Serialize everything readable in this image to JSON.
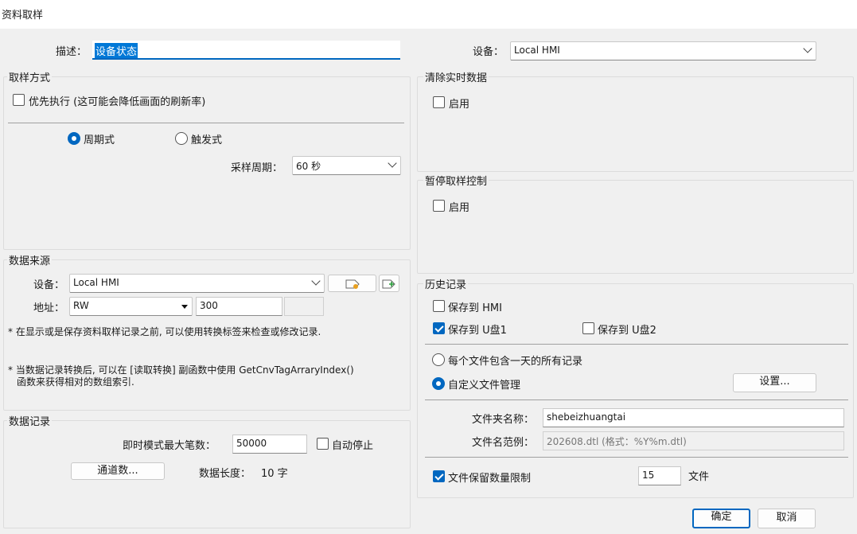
{
  "window": {
    "title": "资料取样"
  },
  "top": {
    "desc_label": "描述：",
    "desc_value": "设备状态",
    "device_label": "设备：",
    "device_value": "Local HMI"
  },
  "sampling": {
    "title": "取样方式",
    "priority_label": "优先执行 (这可能会降低画面的刷新率)",
    "priority_checked": false,
    "periodic_label": "周期式",
    "trigger_label": "触发式",
    "selected_mode": "periodic",
    "period_label": "采样周期：",
    "period_value": "60 秒"
  },
  "clear_realtime": {
    "title": "清除实时数据",
    "enable_label": "启用",
    "checked": false
  },
  "pause": {
    "title": "暂停取样控制",
    "enable_label": "启用",
    "checked": false
  },
  "source": {
    "title": "数据来源",
    "device_label": "设备：",
    "device_value": "Local HMI",
    "address_label": "地址：",
    "address_type": "RW",
    "address_value": "300",
    "note1": "* 在显示或是保存资料取样记录之前, 可以使用转换标签来检查或修改记录.",
    "note2_line1": "* 当数据记录转换后, 可以在 [读取转换] 副函数中使用 GetCnvTagArraryIndex()",
    "note2_line2": "函数来获得相对的数组索引."
  },
  "record": {
    "title": "数据记录",
    "max_label": "即时模式最大笔数：",
    "max_value": "50000",
    "auto_stop_label": "自动停止",
    "auto_stop_checked": false,
    "channel_button": "通道数...",
    "length_label": "数据长度：",
    "length_value": "10 字"
  },
  "history": {
    "title": "历史记录",
    "save_hmi_label": "保存到 HMI",
    "save_hmi_checked": false,
    "save_u1_label": "保存到 U盘1",
    "save_u1_checked": true,
    "save_u2_label": "保存到 U盘2",
    "save_u2_checked": false,
    "per_day_label": "每个文件包含一天的所有记录",
    "custom_label": "自定义文件管理",
    "selected_file_mode": "custom",
    "settings_button": "设置...",
    "folder_label": "文件夹名称：",
    "folder_value": "shebeizhuangtai",
    "example_label": "文件名范例：",
    "example_value": "202608.dtl (格式：%Y%m.dtl)",
    "limit_label": "文件保留数量限制",
    "limit_checked": true,
    "limit_value": "15",
    "limit_unit": "文件"
  },
  "footer": {
    "ok_button": "确定",
    "cancel_button": "取消"
  },
  "colors": {
    "accent": "#0067c0",
    "selection": "#0078d7"
  }
}
